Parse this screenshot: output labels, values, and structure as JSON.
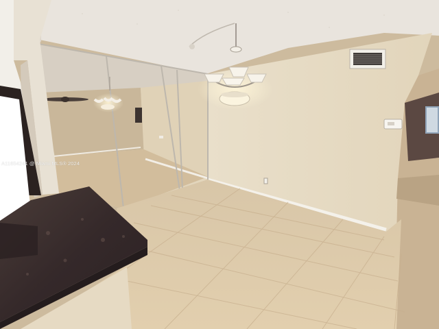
{
  "photo": {
    "watermark": "A11654241 @ Miami MLS® 2024",
    "colors": {
      "ceiling": "#ebe6df",
      "wall": "#e6dbc4",
      "floor": "#d9c4a6",
      "countertop": "#3a2f2c",
      "baseboard": "#f5f2ec",
      "mirror_frame": "#bdb7ad"
    },
    "icons": [
      "chandelier-icon",
      "air-vent-icon",
      "thermostat-icon",
      "ceiling-fan-icon"
    ]
  }
}
